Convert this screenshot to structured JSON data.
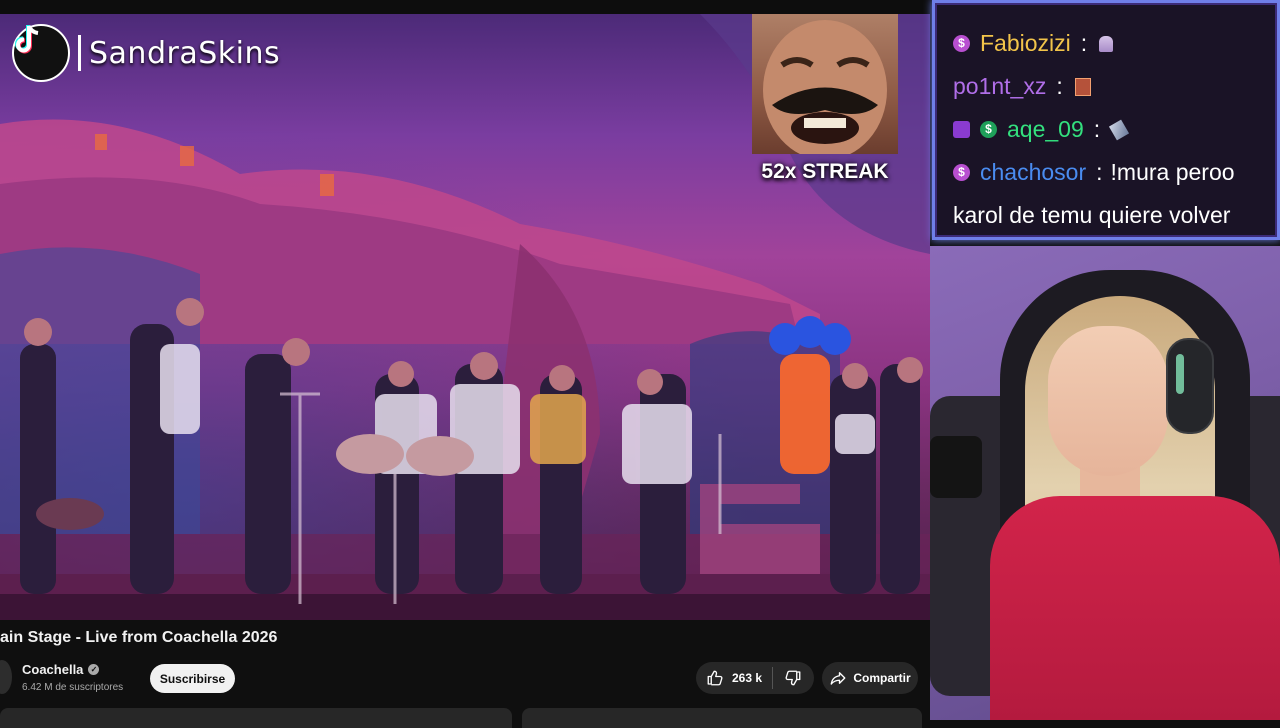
{
  "overlay": {
    "brand_name": "SandraSkins",
    "streak_label": "52x STREAK"
  },
  "chat": {
    "messages": [
      {
        "user": "Fabiozizi",
        "color": "#f2c44a",
        "text": "",
        "badges": [
          "purple"
        ]
      },
      {
        "user": "po1nt_xz",
        "color": "#b06ee8",
        "text": "",
        "badges": []
      },
      {
        "user": "aqe_09",
        "color": "#33e07e",
        "text": "",
        "badges": [
          "cube",
          "green"
        ]
      },
      {
        "user": "chachosor",
        "color": "#4a8cf0",
        "text": "!mura peroo",
        "badges": [
          "purple"
        ]
      },
      {
        "user": "",
        "color": "#ffffff",
        "text": "karol de temu quiere volver",
        "badges": []
      }
    ]
  },
  "video": {
    "title": "ain Stage - Live from Coachella 2026",
    "channel": "Coachella",
    "subscribers": "6.42 M de suscriptores",
    "subscribe_label": "Suscribirse",
    "likes": "263 k",
    "share_label": "Compartir"
  },
  "colors": {
    "chat_border": "#6f7fe8",
    "chat_bg": "#1a1326",
    "youtube_dark": "#0f0f0f"
  },
  "icons": [
    "tiktok-icon",
    "like-icon",
    "dislike-icon",
    "share-icon",
    "verified-icon"
  ]
}
